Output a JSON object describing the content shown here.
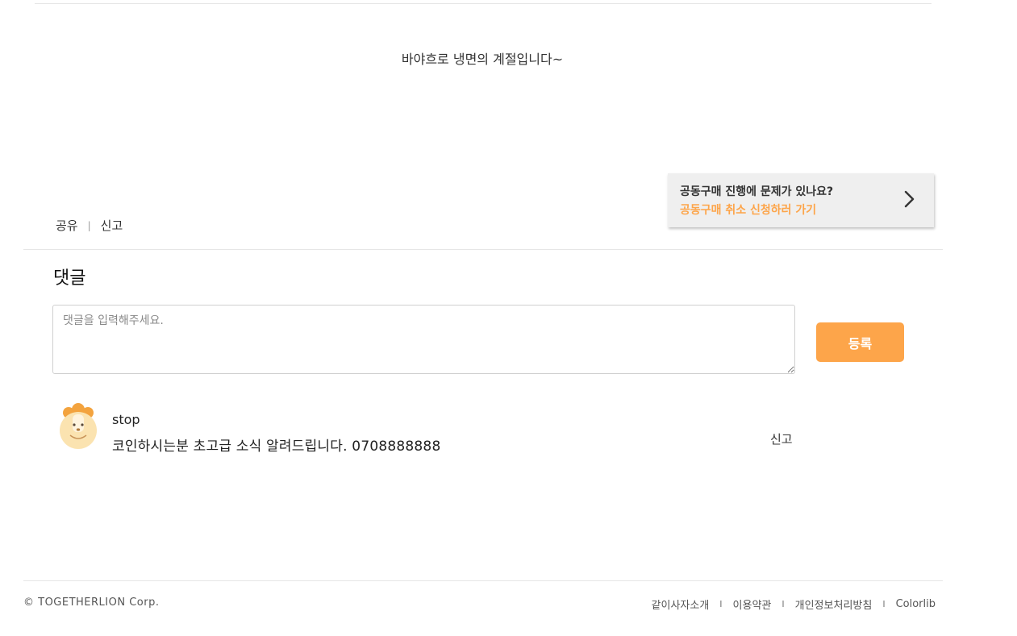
{
  "post": {
    "body": "바야흐로 냉면의 계절입니다~"
  },
  "actions": {
    "share_label": "공유",
    "separator": "|",
    "report_label": "신고"
  },
  "cancel_banner": {
    "question": "공동구매 진행에 문제가 있나요?",
    "action": "공동구매 취소 신청하러 가기",
    "icon": "chevron-right-icon"
  },
  "comments": {
    "title": "댓글",
    "input_placeholder": "댓글을 입력해주세요.",
    "input_value": "",
    "submit_label": "등록",
    "items": [
      {
        "author": "stop",
        "text": "코인하시는분 초고급 소식 알려드립니다. 0708888888",
        "report_label": "신고",
        "avatar": "lion-avatar-icon"
      }
    ]
  },
  "footer": {
    "copyright": "© TOGETHERLION Corp.",
    "links": [
      "같이사자소개",
      "이용약관",
      "개인정보처리방침",
      "Colorlib"
    ],
    "separator": "I"
  },
  "colors": {
    "accent": "#fda54a",
    "banner_bg": "#efefef",
    "rule": "#e6e6e6"
  }
}
